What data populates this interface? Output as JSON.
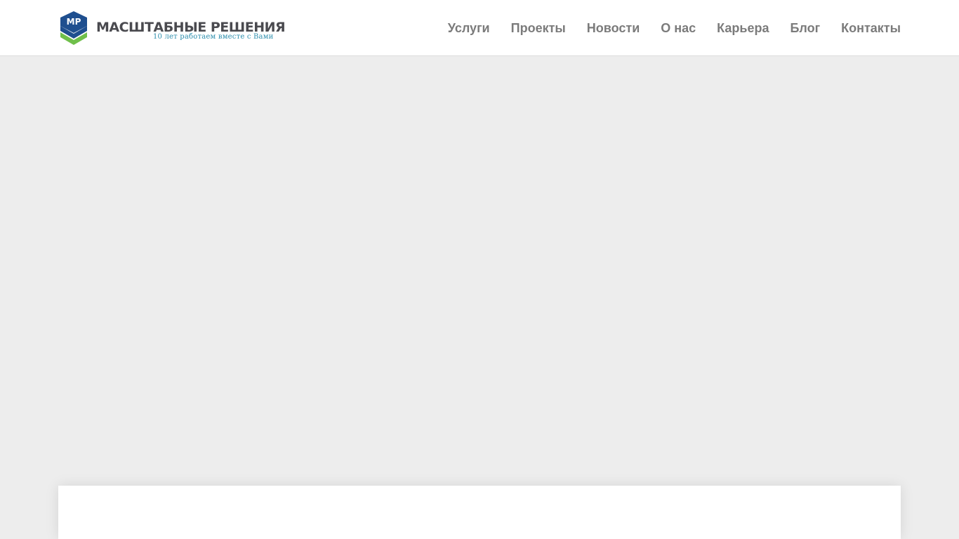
{
  "header": {
    "logo": {
      "mark_text": "МР",
      "title": "МАСШТАБНЫЕ РЕШЕНИЯ",
      "tagline": "10 лет работаем вместе с Вами",
      "colors": {
        "blue": "#1f4f8f",
        "green": "#6fbf4a",
        "title": "#4a4a4f",
        "tagline": "#2e8fae"
      }
    },
    "nav": [
      {
        "label": "Услуги"
      },
      {
        "label": "Проекты"
      },
      {
        "label": "Новости"
      },
      {
        "label": "О нас"
      },
      {
        "label": "Карьера"
      },
      {
        "label": "Блог"
      },
      {
        "label": "Контакты"
      }
    ]
  },
  "colors": {
    "page_background": "#ededed",
    "header_background": "#ffffff",
    "nav_text": "#7b7b7b"
  }
}
